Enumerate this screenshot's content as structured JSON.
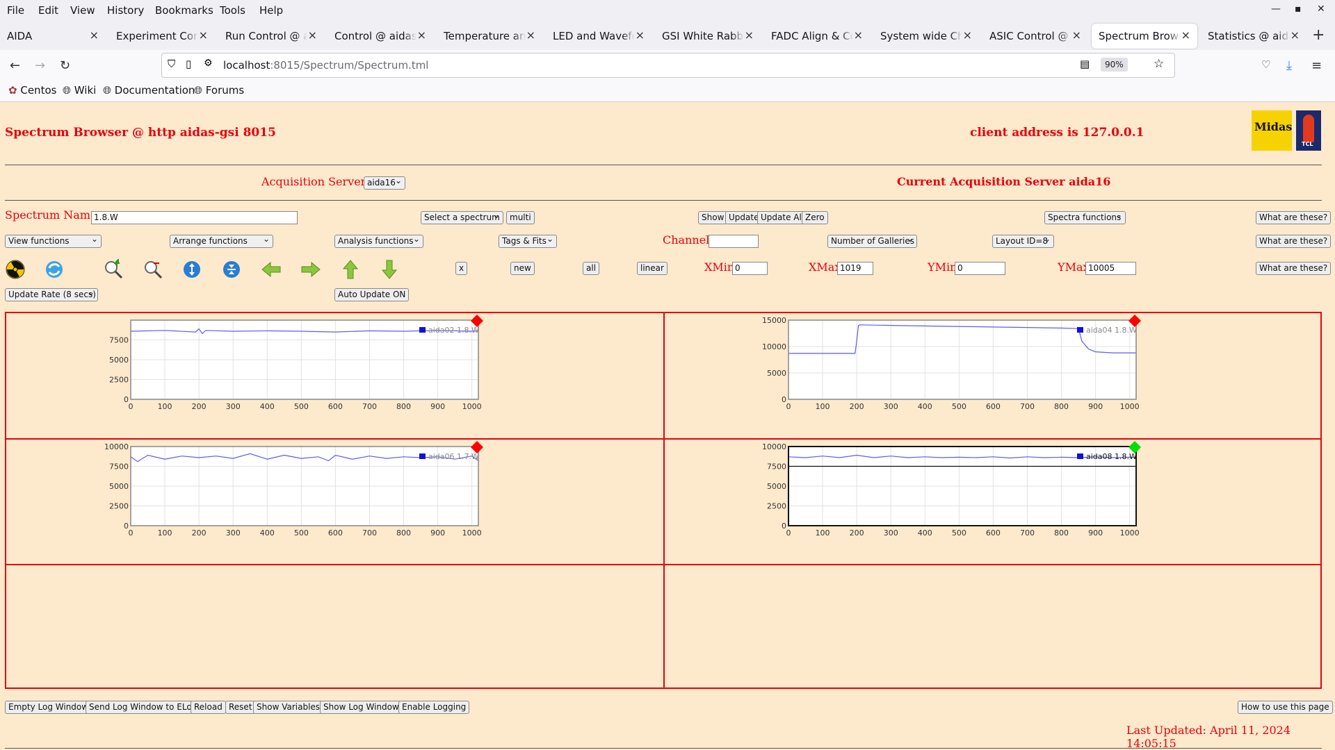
{
  "menubar": {
    "items": [
      "File",
      "Edit",
      "View",
      "History",
      "Bookmarks",
      "Tools",
      "Help"
    ]
  },
  "tabs": [
    {
      "label": "AIDA",
      "active": false
    },
    {
      "label": "Experiment Control",
      "active": false
    },
    {
      "label": "Run Control @ aidas-gsi",
      "active": false
    },
    {
      "label": "Control @ aidas-gsi",
      "active": false
    },
    {
      "label": "Temperature and status",
      "active": false
    },
    {
      "label": "LED and Waveform",
      "active": false
    },
    {
      "label": "GSI White Rabbit Trigger",
      "active": false
    },
    {
      "label": "FADC Align & Control",
      "active": false
    },
    {
      "label": "System wide Checks",
      "active": false
    },
    {
      "label": "ASIC Control @ aidas",
      "active": false
    },
    {
      "label": "Spectrum Browser",
      "active": true
    },
    {
      "label": "Statistics @ aidas-gsi",
      "active": false
    }
  ],
  "url": {
    "host": "localhost",
    "rest": ":8015/Spectrum/Spectrum.tml",
    "zoom": "90%"
  },
  "bookmarks": [
    "Centos",
    "Wiki",
    "Documentation",
    "Forums"
  ],
  "header": {
    "title": "Spectrum Browser @ http aidas-gsi 8015",
    "client": "client address is 127.0.0.1",
    "logo_text": "Midas",
    "logo2_text": "TCL"
  },
  "servers": {
    "label": "Acquisition Servers",
    "selected": "aida16",
    "current": "Current Acquisition Server aida16"
  },
  "controls": {
    "spectrum_name_label": "Spectrum Name:",
    "spectrum_name_value": "1.8.W",
    "select_spectrum": "Select a spectrum",
    "multi": "multi",
    "show": "Show",
    "update": "Update",
    "update_all": "Update All",
    "zero": "Zero",
    "spectra_functions": "Spectra functions",
    "what": "What are these?",
    "view_functions": "View functions",
    "arrange_functions": "Arrange functions",
    "analysis_functions": "Analysis functions",
    "tags_fits": "Tags & Fits",
    "channel_label": "Channel:",
    "channel_value": "",
    "num_galleries": "Number of Galleries",
    "layout": "Layout ID=8",
    "x": "x",
    "new": "new",
    "all": "all",
    "linear": "linear",
    "xmin_label": "XMin",
    "xmin": "0",
    "xmax_label": "XMax",
    "xmax": "1019",
    "ymin_label": "YMin",
    "ymin": "0",
    "ymax_label": "YMax",
    "ymax": "10005",
    "update_rate": "Update Rate (8 secs)",
    "auto_update": "Auto Update ON"
  },
  "icons": [
    "radiation-icon",
    "refresh-icon",
    "zoom-in-icon",
    "zoom-out-icon",
    "expand-y-icon",
    "compress-y-icon",
    "arrow-left-icon",
    "arrow-right-icon",
    "arrow-up-icon",
    "arrow-down-icon"
  ],
  "colors": {
    "accent": "#e8000d",
    "page_bg": "#fde9cc",
    "trace": "#5a5aff",
    "marker_red": "#ff0000",
    "marker_green": "#00e000"
  },
  "chart_data": [
    {
      "type": "line",
      "legend": "aida02 1.8.W",
      "xlim": [
        0,
        1019
      ],
      "ylim": [
        0,
        10000
      ],
      "xticks": [
        0,
        100,
        200,
        300,
        400,
        500,
        600,
        700,
        800,
        900,
        1000
      ],
      "yticks": [
        0,
        2500,
        5000,
        7500
      ],
      "series": [
        {
          "name": "aida02 1.8.W",
          "x": [
            0,
            100,
            190,
            200,
            210,
            220,
            300,
            400,
            500,
            600,
            700,
            800,
            900,
            1000,
            1019
          ],
          "y": [
            8600,
            8700,
            8500,
            8900,
            8300,
            8700,
            8600,
            8650,
            8600,
            8500,
            8650,
            8600,
            8700,
            8600,
            8650
          ]
        }
      ],
      "marker": "red"
    },
    {
      "type": "line",
      "legend": "aida04 1.8.W",
      "xlim": [
        0,
        1019
      ],
      "ylim": [
        0,
        15000
      ],
      "xticks": [
        0,
        100,
        200,
        300,
        400,
        500,
        600,
        700,
        800,
        900,
        1000
      ],
      "yticks": [
        0,
        5000,
        10000,
        15000
      ],
      "series": [
        {
          "name": "aida04 1.8.W",
          "x": [
            0,
            195,
            200,
            205,
            210,
            300,
            400,
            500,
            600,
            700,
            800,
            850,
            860,
            880,
            900,
            950,
            1000,
            1019
          ],
          "y": [
            8700,
            8700,
            11000,
            14000,
            14100,
            14000,
            13900,
            13800,
            13700,
            13600,
            13500,
            13400,
            11000,
            9500,
            9000,
            8800,
            8800,
            8800
          ]
        }
      ],
      "marker": "red"
    },
    {
      "type": "line",
      "legend": "aida06 1.7.W",
      "xlim": [
        0,
        1019
      ],
      "ylim": [
        0,
        10000
      ],
      "xticks": [
        0,
        100,
        200,
        300,
        400,
        500,
        600,
        700,
        800,
        900,
        1000
      ],
      "yticks": [
        0,
        2500,
        5000,
        7500,
        10000
      ],
      "series": [
        {
          "name": "aida06 1.7.W",
          "x": [
            0,
            20,
            50,
            100,
            150,
            200,
            250,
            300,
            350,
            400,
            450,
            500,
            550,
            580,
            600,
            650,
            700,
            750,
            800,
            850,
            900,
            950,
            1000,
            1019
          ],
          "y": [
            8700,
            8100,
            8900,
            8400,
            8800,
            8600,
            8800,
            8500,
            9100,
            8400,
            8900,
            8500,
            8700,
            8200,
            8900,
            8400,
            8800,
            8500,
            8700,
            8600,
            8700,
            8400,
            8800,
            8200
          ]
        }
      ],
      "marker": "red"
    },
    {
      "type": "line",
      "legend": "aida08 1.8.W",
      "xlim": [
        0,
        1019
      ],
      "ylim": [
        0,
        10000
      ],
      "xticks": [
        0,
        100,
        200,
        300,
        400,
        500,
        600,
        700,
        800,
        900,
        1000
      ],
      "yticks": [
        0,
        2500,
        5000,
        7500,
        10000
      ],
      "series": [
        {
          "name": "aida08 1.8.W",
          "x": [
            0,
            50,
            100,
            150,
            200,
            250,
            300,
            350,
            400,
            450,
            500,
            550,
            600,
            650,
            700,
            750,
            800,
            850,
            900,
            950,
            1000,
            1019
          ],
          "y": [
            8700,
            8600,
            8800,
            8600,
            8900,
            8600,
            8800,
            8600,
            8700,
            8600,
            8650,
            8600,
            8700,
            8550,
            8700,
            8600,
            8650,
            8600,
            8700,
            8600,
            8650,
            8600
          ]
        }
      ],
      "marker": "green",
      "hline": 7500,
      "selected": true
    }
  ],
  "bottom": {
    "empty_log": "Empty Log Window",
    "send_log": "Send Log Window to ELog",
    "reload": "Reload",
    "reset": "Reset",
    "show_vars": "Show Variables",
    "show_log": "Show Log Window",
    "enable_logging": "Enable Logging",
    "howto": "How to use this page",
    "last_updated": "Last Updated: April 11, 2024 14:05:15"
  }
}
